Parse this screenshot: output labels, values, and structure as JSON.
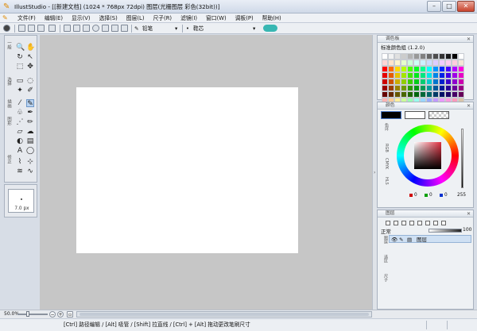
{
  "window": {
    "title": "IllustStudio - [[新建文档] (1024 * 768px 72dpi)    图层(光栅图层 彩色(32bit))]",
    "minimize": "–",
    "maximize": "□",
    "close": "✕"
  },
  "menu": [
    "文件(F)",
    "编辑(E)",
    "显示(V)",
    "选择(S)",
    "图层(L)",
    "尺子(R)",
    "滤镜(I)",
    "窗口(W)",
    "调板(P)",
    "帮助(H)"
  ],
  "toolbar": {
    "brush_name": "铅笔",
    "tip_name": "鞋芯"
  },
  "tool_labels": [
    "一般",
    "选择",
    "描画",
    "图形",
    "修正"
  ],
  "brush": {
    "size": "7.0 px"
  },
  "palette": {
    "header": "调色板",
    "set_name": "标准颜色组 (1.2.0)"
  },
  "color_panel": {
    "header": "颜色",
    "tabs": [
      "色环",
      "RGB",
      "CMYK",
      "HLS"
    ],
    "r": "0",
    "g": "0",
    "b": "0",
    "v": "255"
  },
  "layer_panel": {
    "header": "图层",
    "blend_mode": "正常",
    "opacity": "100",
    "tabs": [
      "图层",
      "选区",
      "尺子"
    ],
    "layers": [
      {
        "name": "图层"
      }
    ]
  },
  "zoom": {
    "value": "50.0%"
  },
  "status": {
    "hint": "[Ctrl] 路径编辑 / [Alt] 吸管 / [Shift] 拉直线 / [Ctrl] + [Alt] 拖动更改笔刷尺寸"
  },
  "colors": {
    "canvas_bg": "#c6c6c6",
    "canvas": "#ffffff",
    "accent": "#38b7b3",
    "swatches": [
      "#ffffff",
      "#f2f2f2",
      "#e0e0e0",
      "#cccccc",
      "#b3b3b3",
      "#999999",
      "#808080",
      "#666666",
      "#4d4d4d",
      "#333333",
      "#1a1a1a",
      "#000000",
      "#ffffff",
      "#ffd6d6",
      "#ffe4cc",
      "#fff5cc",
      "#e6ffcc",
      "#ccffd9",
      "#ccfff5",
      "#ccf0ff",
      "#ccdcff",
      "#dcccff",
      "#f0ccff",
      "#ffccf0",
      "#ffccdd",
      "#f5e6d6",
      "#ff0000",
      "#ff6a00",
      "#ffd800",
      "#b6ff00",
      "#4cff00",
      "#00ff21",
      "#00ff90",
      "#00ffff",
      "#0094ff",
      "#0026ff",
      "#4800ff",
      "#b200ff",
      "#ff00dc",
      "#e60000",
      "#e65c00",
      "#e6c200",
      "#a3e600",
      "#44e600",
      "#00e61d",
      "#00e681",
      "#00e6e6",
      "#0085e6",
      "#0022e6",
      "#4100e6",
      "#a000e6",
      "#e600c6",
      "#cc0000",
      "#cc5200",
      "#ccad00",
      "#91cc00",
      "#3dcc00",
      "#00cc1a",
      "#00cc73",
      "#00cccc",
      "#0076cc",
      "#001ecc",
      "#3a00cc",
      "#8e00cc",
      "#cc00b0",
      "#990000",
      "#993d00",
      "#998200",
      "#6d9900",
      "#2e9900",
      "#009913",
      "#009956",
      "#009999",
      "#005899",
      "#001799",
      "#2b0099",
      "#6b0099",
      "#990084",
      "#660000",
      "#662900",
      "#665600",
      "#486600",
      "#1e6600",
      "#00660d",
      "#006639",
      "#006666",
      "#003b66",
      "#000f66",
      "#1d0066",
      "#470066",
      "#660058",
      "#ffb3b3",
      "#ffcc99",
      "#ffee99",
      "#ccff99",
      "#99ffb3",
      "#99ffee",
      "#99d6ff",
      "#99aaff",
      "#c299ff",
      "#eb99ff",
      "#ff99e0",
      "#ff99bb",
      "#d9c4a8"
    ]
  }
}
